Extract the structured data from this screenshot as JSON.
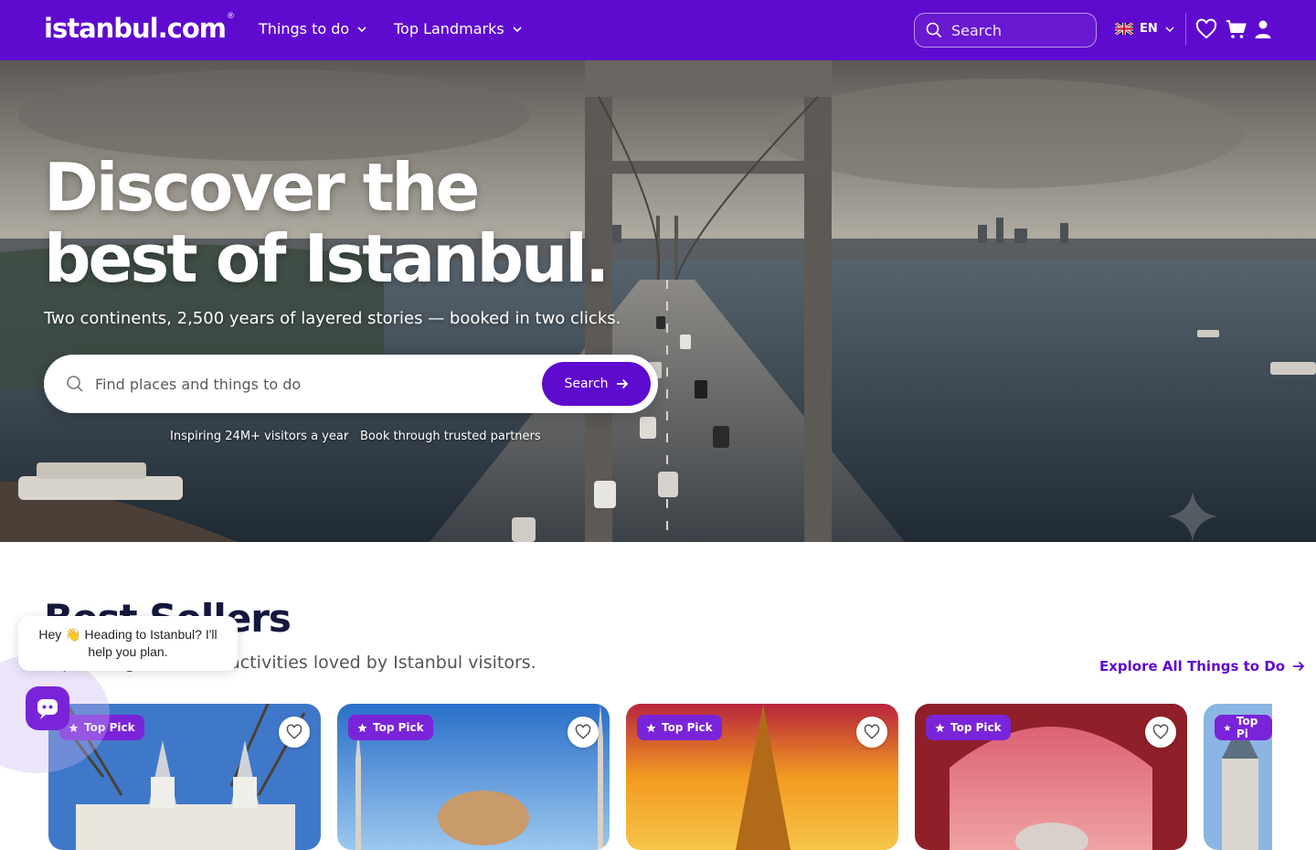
{
  "nav": {
    "logo": "istanbul.com",
    "logo_mark": "®",
    "links": [
      {
        "label": "Things to do"
      },
      {
        "label": "Top Landmarks"
      }
    ],
    "search_placeholder": "Search",
    "language": "EN",
    "brand_color": "#5f0bcf"
  },
  "hero": {
    "title_line1": "Discover the",
    "title_line2": "best of Istanbul.",
    "subtitle": "Two continents, 2,500 years of layered stories — booked in two clicks.",
    "search_placeholder": "Find places and things to do",
    "search_button": "Search",
    "trust_items": [
      "Inspiring 24M+ visitors a year",
      "Book through trusted partners"
    ],
    "trust_separator": "·"
  },
  "best_sellers": {
    "title": "Best Sellers",
    "subtitle": "Top-selling tours and activities loved by Istanbul visitors.",
    "explore_link": "Explore All Things to Do",
    "cards": [
      {
        "badge": "Top Pick"
      },
      {
        "badge": "Top Pick"
      },
      {
        "badge": "Top Pick"
      },
      {
        "badge": "Top Pick"
      },
      {
        "badge": "Top Pi"
      }
    ]
  },
  "chat": {
    "message": "Hey 👋 Heading to Istanbul? I'll help you plan."
  }
}
